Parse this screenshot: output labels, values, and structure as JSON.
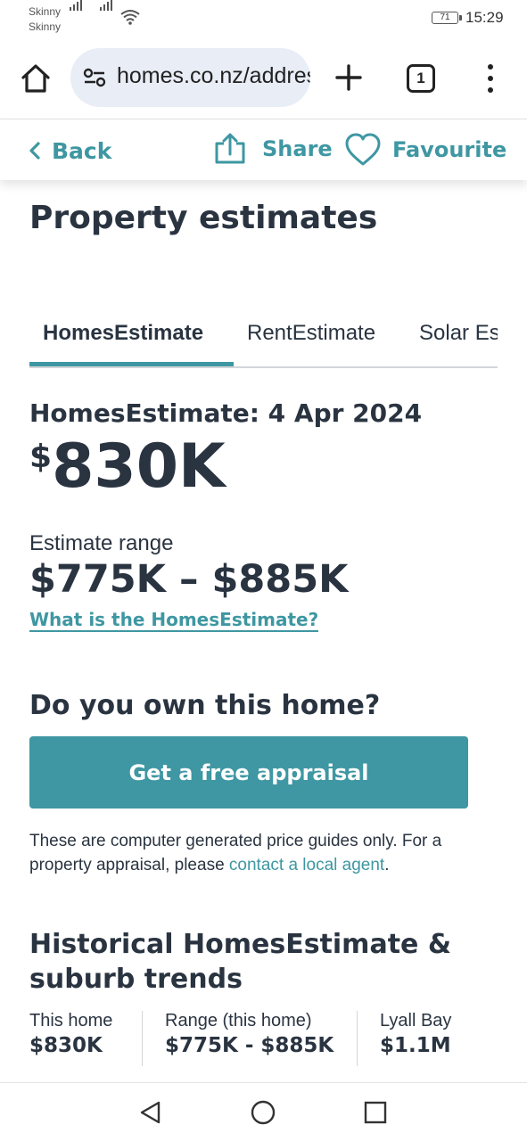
{
  "status_bar": {
    "carrier_line1": "Skinny",
    "carrier_line2": "Skinny",
    "battery": "71",
    "time": "15:29"
  },
  "browser": {
    "url": "homes.co.nz/address",
    "tab_count": "1"
  },
  "action_bar": {
    "back_label": "Back",
    "share_label": "Share",
    "favourite_label": "Favourite",
    "accent_color": "#3e97a2"
  },
  "page": {
    "title": "Property estimates"
  },
  "tabs": [
    {
      "label": "HomesEstimate",
      "active": true
    },
    {
      "label": "RentEstimate",
      "active": false
    },
    {
      "label": "Solar Estimate",
      "active": false
    }
  ],
  "estimate": {
    "heading": "HomesEstimate: 4 Apr 2024",
    "currency": "$",
    "value": "830K",
    "range_label": "Estimate range",
    "range_value": "$775K – $885K",
    "what_link": "What is the HomesEstimate?"
  },
  "ownership": {
    "heading": "Do you own this home?",
    "button_label": "Get a free appraisal",
    "disclaimer_prefix": "These are computer generated price guides only. For a property appraisal, please ",
    "disclaimer_link": "contact a local agent",
    "disclaimer_suffix": "."
  },
  "history": {
    "heading": "Historical HomesEstimate & suburb trends",
    "columns": [
      {
        "label": "This home",
        "value": "$830K"
      },
      {
        "label": "Range (this home)",
        "value": "$775K - $885K"
      },
      {
        "label": "Lyall Bay",
        "value": "$1.1M"
      }
    ]
  }
}
